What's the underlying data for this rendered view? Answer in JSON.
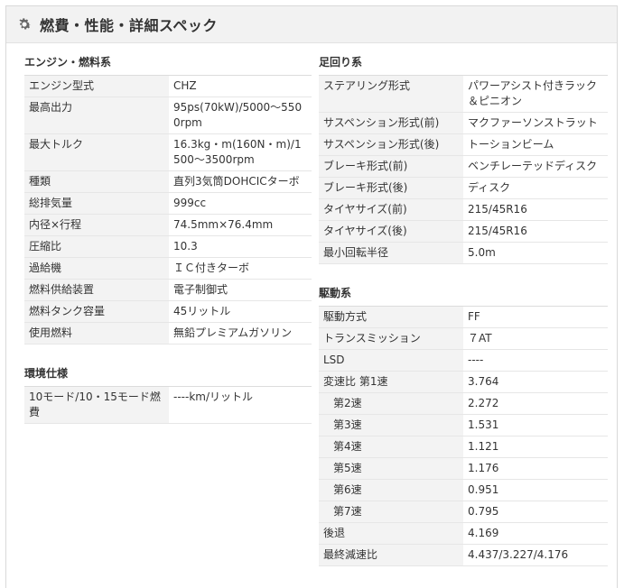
{
  "header": {
    "title": "燃費・性能・詳細スペック",
    "icon": "gear-icon"
  },
  "engine": {
    "title": "エンジン・燃料系",
    "rows": [
      {
        "k": "エンジン型式",
        "v": "CHZ"
      },
      {
        "k": "最高出力",
        "v": "95ps(70kW)/5000～5500rpm"
      },
      {
        "k": "最大トルク",
        "v": "16.3kg・m(160N・m)/1500～3500rpm"
      },
      {
        "k": "種類",
        "v": "直列3気筒DOHCICターボ"
      },
      {
        "k": "総排気量",
        "v": "999cc"
      },
      {
        "k": "内径×行程",
        "v": "74.5mm×76.4mm"
      },
      {
        "k": "圧縮比",
        "v": "10.3"
      },
      {
        "k": "過給機",
        "v": "ＩＣ付きターボ"
      },
      {
        "k": "燃料供給装置",
        "v": "電子制御式"
      },
      {
        "k": "燃料タンク容量",
        "v": "45リットル"
      },
      {
        "k": "使用燃料",
        "v": "無鉛プレミアムガソリン"
      }
    ]
  },
  "environment": {
    "title": "環境仕様",
    "rows": [
      {
        "k": "10モード/10・15モード燃費",
        "v": "----km/リットル"
      }
    ]
  },
  "suspension": {
    "title": "足回り系",
    "rows": [
      {
        "k": "ステアリング形式",
        "v": "パワーアシスト付きラック＆ピニオン"
      },
      {
        "k": "サスペンション形式(前)",
        "v": "マクファーソンストラット"
      },
      {
        "k": "サスペンション形式(後)",
        "v": "トーションビーム"
      },
      {
        "k": "ブレーキ形式(前)",
        "v": "ベンチレーテッドディスク"
      },
      {
        "k": "ブレーキ形式(後)",
        "v": "ディスク"
      },
      {
        "k": "タイヤサイズ(前)",
        "v": "215/45R16"
      },
      {
        "k": "タイヤサイズ(後)",
        "v": "215/45R16"
      },
      {
        "k": "最小回転半径",
        "v": "5.0m"
      }
    ]
  },
  "drive": {
    "title": "駆動系",
    "rows": [
      {
        "k": "駆動方式",
        "v": "FF",
        "indent": false
      },
      {
        "k": "トランスミッション",
        "v": "７AT",
        "indent": false
      },
      {
        "k": "LSD",
        "v": "----",
        "indent": false
      },
      {
        "k": "変速比 第1速",
        "v": "3.764",
        "indent": false
      },
      {
        "k": "第2速",
        "v": "2.272",
        "indent": true
      },
      {
        "k": "第3速",
        "v": "1.531",
        "indent": true
      },
      {
        "k": "第4速",
        "v": "1.121",
        "indent": true
      },
      {
        "k": "第5速",
        "v": "1.176",
        "indent": true
      },
      {
        "k": "第6速",
        "v": "0.951",
        "indent": true
      },
      {
        "k": "第7速",
        "v": "0.795",
        "indent": true
      },
      {
        "k": "後退",
        "v": "4.169",
        "indent": false
      },
      {
        "k": "最終減速比",
        "v": "4.437/3.227/4.176",
        "indent": false
      }
    ]
  }
}
